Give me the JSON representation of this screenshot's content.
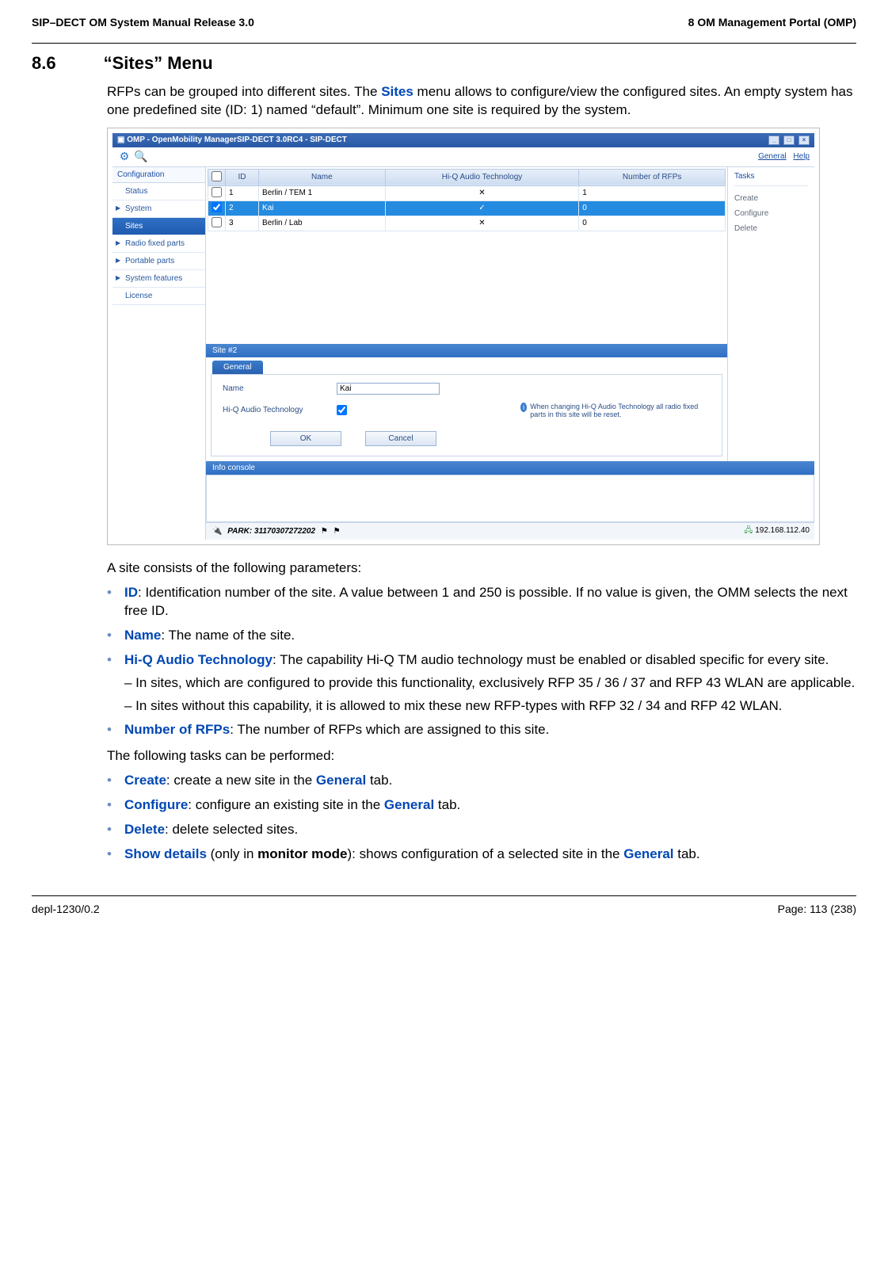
{
  "doc_header": {
    "left": "SIP–DECT OM System Manual Release 3.0",
    "right": "8 OM Management Portal (OMP)"
  },
  "section": {
    "num": "8.6",
    "title": "“Sites” Menu"
  },
  "intro_p1": "RFPs can be grouped into different sites. The ",
  "intro_sites": "Sites",
  "intro_p2": " menu allows to configure/view the configured sites. An empty system has one predefined site (ID: 1) named “default”. Minimum one site is required by the system.",
  "app": {
    "title": "OMP - OpenMobility ManagerSIP-DECT 3.0RC4 - SIP-DECT",
    "win_buttons": {
      "min": "_",
      "max": "□",
      "close": "×"
    },
    "toolbar": {
      "gear_icon": "⚙",
      "search_icon": "🔍",
      "link_general": "General",
      "link_help": "Help"
    },
    "nav": {
      "header": "Configuration",
      "items": [
        "Status",
        "System",
        "Sites",
        "Radio fixed parts",
        "Portable parts",
        "System features",
        "License"
      ],
      "active_index": 2,
      "expandable": [
        false,
        true,
        false,
        true,
        true,
        true,
        false
      ]
    },
    "table": {
      "cols": [
        "",
        "ID",
        "Name",
        "Hi-Q Audio Technology",
        "Number of RFPs"
      ],
      "rows": [
        {
          "chk": false,
          "id": "1",
          "name": "Berlin / TEM 1",
          "hiq": "✕",
          "rfps": "1",
          "selected": false
        },
        {
          "chk": true,
          "id": "2",
          "name": "Kai",
          "hiq": "✓",
          "rfps": "0",
          "selected": true
        },
        {
          "chk": false,
          "id": "3",
          "name": "Berlin / Lab",
          "hiq": "✕",
          "rfps": "0",
          "selected": false
        }
      ]
    },
    "tasks": {
      "title": "Tasks",
      "items": [
        "Create",
        "Configure",
        "Delete"
      ]
    },
    "editor": {
      "header": "Site #2",
      "tab": "General",
      "name_label": "Name",
      "name_value": "Kai",
      "hiq_label": "Hi-Q Audio Technology",
      "hiq_checked": true,
      "note": "When changing Hi-Q Audio Technology all radio fixed parts in this site will be reset.",
      "ok": "OK",
      "cancel": "Cancel"
    },
    "info_console": "Info console",
    "status": {
      "park_label": "PARK: 31170307272202",
      "ip": "192.168.112.40"
    }
  },
  "params_intro": "A site consists of the following parameters:",
  "params": {
    "id_label": "ID",
    "id_text": ": Identification number of the site. A value between 1 and 250 is possible. If no value is given, the OMM selects the next free ID.",
    "name_label": "Name",
    "name_text": ": The name of the site.",
    "hiq_label": "Hi-Q Audio Technology",
    "hiq_text": ": The capability Hi-Q TM audio technology must be enabled or disabled specific for every site.",
    "hiq_sub1": "– In sites, which are configured to provide this functionality, exclusively RFP 35 / 36 / 37 and RFP 43 WLAN are applicable.",
    "hiq_sub2": "– In sites without this capability, it is allowed to mix these new RFP-types with RFP 32 / 34 and RFP 42 WLAN.",
    "rfps_label": "Number of RFPs",
    "rfps_text": ": The number of RFPs which are assigned to this site."
  },
  "tasks_intro": "The following tasks can be performed:",
  "tasks_list": {
    "create_label": "Create",
    "create_text": ": create a new site in the ",
    "general": "General",
    "tab_suffix": " tab.",
    "configure_label": "Configure",
    "configure_text": ": configure an existing site in the ",
    "delete_label": "Delete",
    "delete_text": ": delete selected sites.",
    "show_label": "Show details",
    "show_mid": " (only in ",
    "monitor": "monitor mode",
    "show_text": "): shows configuration of a selected site in the "
  },
  "footer": {
    "left": "depl-1230/0.2",
    "right": "Page: 113 (238)"
  }
}
